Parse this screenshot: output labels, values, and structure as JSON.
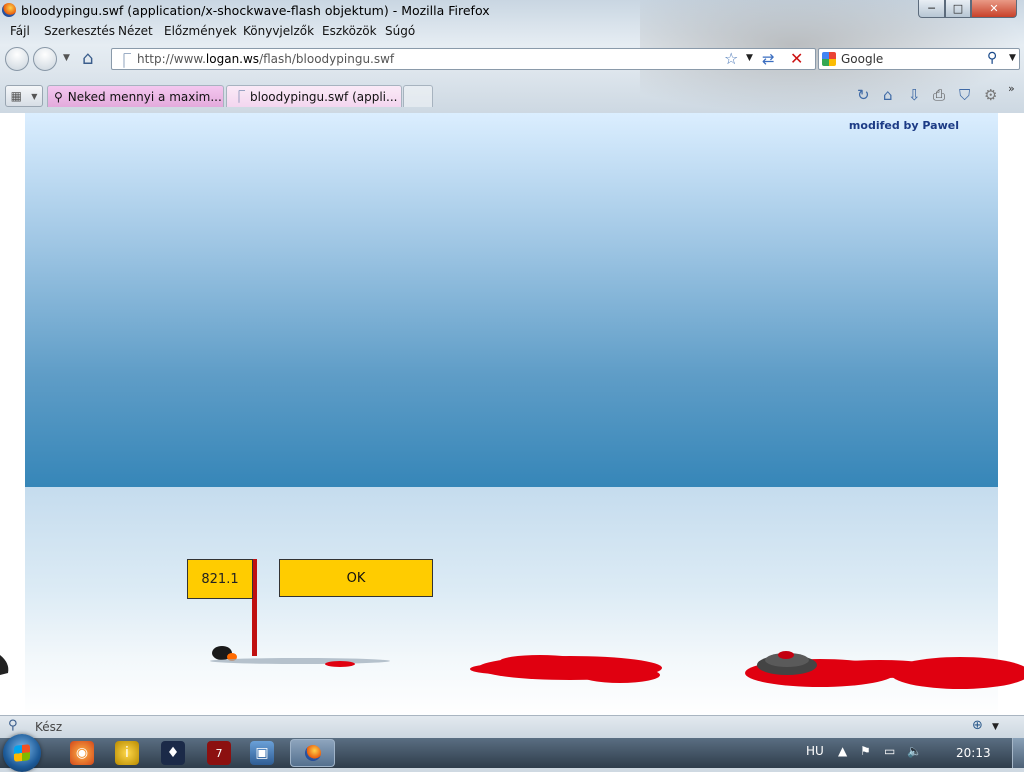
{
  "window": {
    "title": "bloodypingu.swf (application/x-shockwave-flash objektum) - Mozilla Firefox",
    "minimize_label": "─",
    "maximize_label": "□",
    "close_label": "✕"
  },
  "menu": [
    "Fájl",
    "Szerkesztés",
    "Nézet",
    "Előzmények",
    "Könyvjelzők",
    "Eszközök",
    "Súgó"
  ],
  "navbar": {
    "url_prefix": "http://www.",
    "url_domain": "logan.ws",
    "url_path": "/flash/bloodypingu.swf",
    "search_placeholder": "Google"
  },
  "tabs": [
    {
      "label": "Neked mennyi a maxim...",
      "active": false
    },
    {
      "label": "bloodypingu.swf (appli...",
      "active": true
    }
  ],
  "game": {
    "credit": "modifed by Pawel",
    "score": "821.1",
    "ok_label": "OK"
  },
  "statusbar": {
    "text": "Kész"
  },
  "taskbar": {
    "language": "HU",
    "clock": "20:13"
  },
  "colors": {
    "sign": "#ffcc00",
    "blood": "#e00010",
    "sky_bottom": "#3686b8",
    "tab_active": "#f3d6ef",
    "tab_inactive": "#e3aadc"
  }
}
